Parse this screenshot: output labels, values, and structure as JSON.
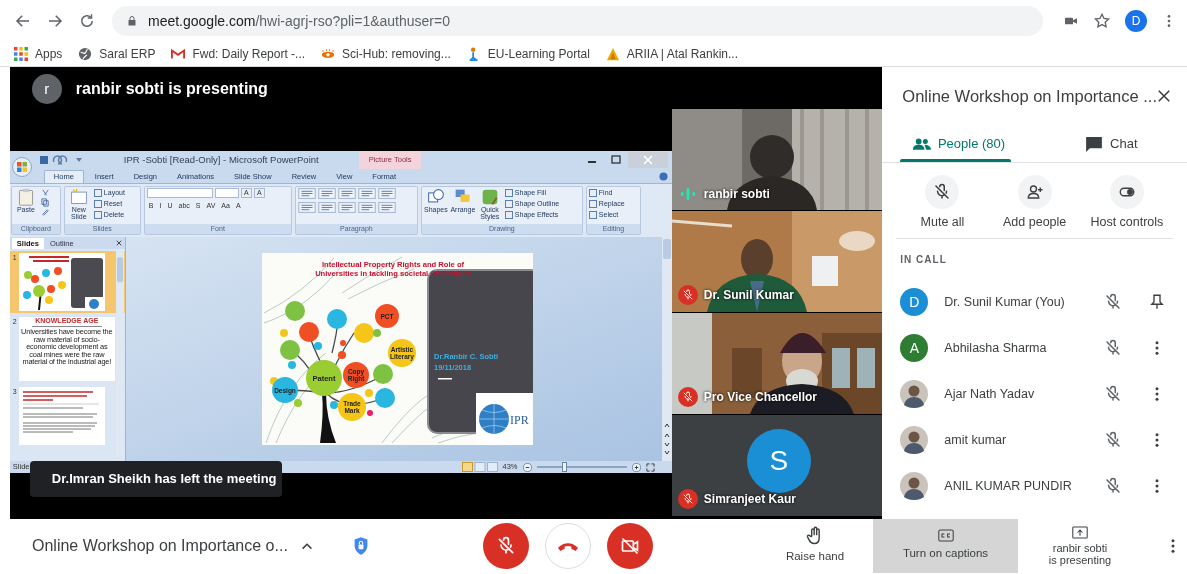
{
  "browser": {
    "url_host": "meet.google.com",
    "url_path": "/hwi-agrj-rso?pli=1&authuser=0",
    "profile_initial": "D",
    "bookmarks": [
      {
        "label": "Apps"
      },
      {
        "label": "Saral ERP"
      },
      {
        "label": "Fwd: Daily Report -..."
      },
      {
        "label": "Sci-Hub: removing..."
      },
      {
        "label": "EU-Learning Portal"
      },
      {
        "label": "ARIIA | Atal Rankin..."
      }
    ]
  },
  "presenting_banner": {
    "initial": "r",
    "text": "ranbir sobti is presenting"
  },
  "powerpoint": {
    "title": "IPR -Sobti [Read-Only] - Microsoft PowerPoint",
    "context_label": "Picture Tools",
    "tabs": [
      {
        "label": "Home",
        "selected": true
      },
      {
        "label": "Insert",
        "selected": false
      },
      {
        "label": "Design",
        "selected": false
      },
      {
        "label": "Animations",
        "selected": false
      },
      {
        "label": "Slide Show",
        "selected": false
      },
      {
        "label": "Review",
        "selected": false
      },
      {
        "label": "View",
        "selected": false
      },
      {
        "label": "Format",
        "selected": false
      }
    ],
    "groups": [
      {
        "label": "Clipboard",
        "kind": "clipboard",
        "buttons": [
          {
            "label": "Paste",
            "kind": "large"
          }
        ]
      },
      {
        "label": "Slides",
        "kind": "buttons",
        "buttons": [
          {
            "label": "New Slide",
            "kind": "large"
          },
          {
            "label": "Layout",
            "kind": "small"
          },
          {
            "label": "Reset",
            "kind": "small"
          },
          {
            "label": "Delete",
            "kind": "small"
          }
        ]
      },
      {
        "label": "Font",
        "kind": "font",
        "row1": [
          "A",
          "A"
        ],
        "row2": [
          "B",
          "I",
          "U",
          "abc",
          "S",
          "AV",
          "Aa",
          "A"
        ]
      },
      {
        "label": "Paragraph",
        "kind": "paragraph"
      },
      {
        "label": "Drawing",
        "kind": "buttons",
        "buttons": [
          {
            "label": "Shapes",
            "kind": "large"
          },
          {
            "label": "Arrange",
            "kind": "large"
          },
          {
            "label": "Quick Styles",
            "kind": "large"
          },
          {
            "label": "Shape Fill",
            "kind": "small"
          },
          {
            "label": "Shape Outline",
            "kind": "small"
          },
          {
            "label": "Shape Effects",
            "kind": "small"
          }
        ]
      },
      {
        "label": "Editing",
        "kind": "buttons",
        "buttons": [
          {
            "label": "Find",
            "kind": "small"
          },
          {
            "label": "Replace",
            "kind": "small"
          },
          {
            "label": "Select",
            "kind": "small"
          }
        ]
      }
    ],
    "pane_tabs": [
      {
        "label": "Slides",
        "selected": true
      },
      {
        "label": "Outline",
        "selected": false
      }
    ],
    "thumbnails": [
      {
        "number": "1",
        "kind": "title_slide",
        "selected": true
      },
      {
        "number": "2",
        "kind": "text",
        "selected": false,
        "heading": "KNOWLEDGE AGE",
        "body": "Universities have become the raw material of socio-economic development as coal mines were the raw material of the industrial age!"
      },
      {
        "number": "3",
        "kind": "bullets",
        "selected": false
      }
    ],
    "slide": {
      "title_lines": [
        "Intellectual Property Rights and Role of",
        "Universities in tackling societal Challenges"
      ],
      "bubbles": [
        {
          "label": "Patent",
          "color": "#9acd32"
        },
        {
          "label": "Design",
          "color": "#29b6e0"
        },
        {
          "label": "PCT",
          "color": "#f04e23"
        },
        {
          "label": "Trade Mark",
          "color": "#f5c518"
        },
        {
          "label": "Copy Right",
          "color": "#f04e23"
        },
        {
          "label": "Artistic Literary",
          "color": "#f5c518"
        }
      ],
      "author": "Dr.Ranbir C. Sobti",
      "date": "19/11/2018",
      "logo_text": "IPR"
    },
    "status_left": "Slide",
    "zoom_text": "43%",
    "zoom_slider": {
      "level": 0.3
    }
  },
  "toast": "Dr.Imran Sheikh has left the meeting",
  "tiles": [
    {
      "name": "ranbir sobti",
      "kind": "video",
      "muted": false
    },
    {
      "name": "Dr. Sunil Kumar",
      "kind": "video",
      "muted": true
    },
    {
      "name": "Pro Vice Chancellor",
      "kind": "video",
      "muted": true
    },
    {
      "name": "Simranjeet Kaur",
      "kind": "avatar",
      "initial": "S",
      "color": "#1a8fd6",
      "muted": true
    }
  ],
  "panel": {
    "title": "Online Workshop on Importance ...",
    "tabs": [
      {
        "label": "People (80)",
        "kind": "people",
        "selected": true
      },
      {
        "label": "Chat",
        "kind": "chat",
        "selected": false
      }
    ],
    "actions": [
      {
        "label": "Mute all",
        "kind": "mute"
      },
      {
        "label": "Add people",
        "kind": "add"
      },
      {
        "label": "Host controls",
        "kind": "toggle"
      }
    ],
    "section": "IN CALL",
    "people": [
      {
        "name": "Dr. Sunil Kumar (You)",
        "kind": "letter",
        "initial": "D",
        "color": "#1a8fd6",
        "muted": true,
        "pin": true
      },
      {
        "name": "Abhilasha Sharma",
        "kind": "letter",
        "initial": "A",
        "color": "#2e7d32",
        "muted": true,
        "pin": false
      },
      {
        "name": "Ajar Nath Yadav",
        "muted": true,
        "pin": false
      },
      {
        "name": "amit kumar",
        "muted": true,
        "pin": false
      },
      {
        "name": "ANIL KUMAR PUNDIR",
        "muted": true,
        "pin": false
      }
    ]
  },
  "bottom": {
    "meeting_title": "Online Workshop on Importance o...",
    "controls": [
      {
        "kind": "mic",
        "on": false
      },
      {
        "kind": "hangup"
      },
      {
        "kind": "camera",
        "on": false
      }
    ],
    "raise_hand": "Raise hand",
    "captions": "Turn on captions",
    "presenting_lines": [
      "ranbir sobti",
      "is presenting"
    ]
  }
}
